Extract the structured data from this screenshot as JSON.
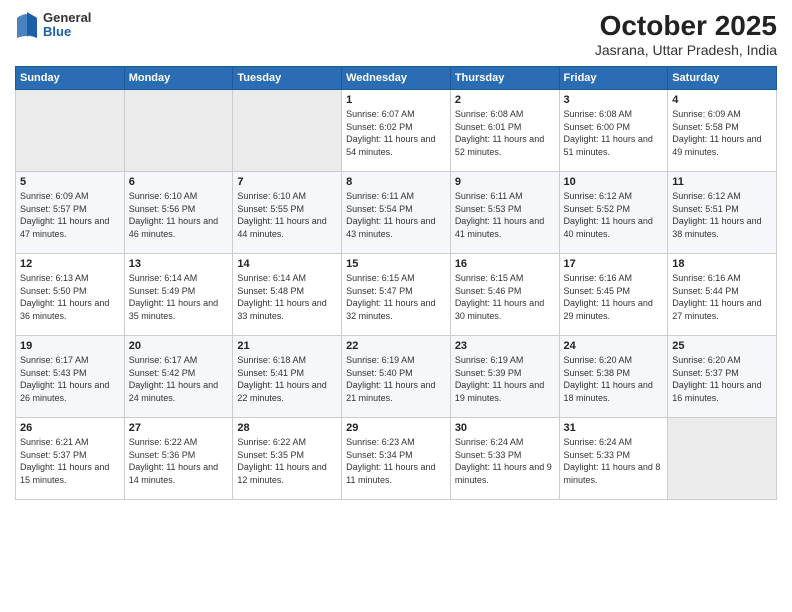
{
  "header": {
    "logo": {
      "general": "General",
      "blue": "Blue"
    },
    "title": "October 2025",
    "subtitle": "Jasrana, Uttar Pradesh, India"
  },
  "weekdays": [
    "Sunday",
    "Monday",
    "Tuesday",
    "Wednesday",
    "Thursday",
    "Friday",
    "Saturday"
  ],
  "weeks": [
    [
      {
        "day": "",
        "sunrise": "",
        "sunset": "",
        "daylight": ""
      },
      {
        "day": "",
        "sunrise": "",
        "sunset": "",
        "daylight": ""
      },
      {
        "day": "",
        "sunrise": "",
        "sunset": "",
        "daylight": ""
      },
      {
        "day": "1",
        "sunrise": "Sunrise: 6:07 AM",
        "sunset": "Sunset: 6:02 PM",
        "daylight": "Daylight: 11 hours and 54 minutes."
      },
      {
        "day": "2",
        "sunrise": "Sunrise: 6:08 AM",
        "sunset": "Sunset: 6:01 PM",
        "daylight": "Daylight: 11 hours and 52 minutes."
      },
      {
        "day": "3",
        "sunrise": "Sunrise: 6:08 AM",
        "sunset": "Sunset: 6:00 PM",
        "daylight": "Daylight: 11 hours and 51 minutes."
      },
      {
        "day": "4",
        "sunrise": "Sunrise: 6:09 AM",
        "sunset": "Sunset: 5:58 PM",
        "daylight": "Daylight: 11 hours and 49 minutes."
      }
    ],
    [
      {
        "day": "5",
        "sunrise": "Sunrise: 6:09 AM",
        "sunset": "Sunset: 5:57 PM",
        "daylight": "Daylight: 11 hours and 47 minutes."
      },
      {
        "day": "6",
        "sunrise": "Sunrise: 6:10 AM",
        "sunset": "Sunset: 5:56 PM",
        "daylight": "Daylight: 11 hours and 46 minutes."
      },
      {
        "day": "7",
        "sunrise": "Sunrise: 6:10 AM",
        "sunset": "Sunset: 5:55 PM",
        "daylight": "Daylight: 11 hours and 44 minutes."
      },
      {
        "day": "8",
        "sunrise": "Sunrise: 6:11 AM",
        "sunset": "Sunset: 5:54 PM",
        "daylight": "Daylight: 11 hours and 43 minutes."
      },
      {
        "day": "9",
        "sunrise": "Sunrise: 6:11 AM",
        "sunset": "Sunset: 5:53 PM",
        "daylight": "Daylight: 11 hours and 41 minutes."
      },
      {
        "day": "10",
        "sunrise": "Sunrise: 6:12 AM",
        "sunset": "Sunset: 5:52 PM",
        "daylight": "Daylight: 11 hours and 40 minutes."
      },
      {
        "day": "11",
        "sunrise": "Sunrise: 6:12 AM",
        "sunset": "Sunset: 5:51 PM",
        "daylight": "Daylight: 11 hours and 38 minutes."
      }
    ],
    [
      {
        "day": "12",
        "sunrise": "Sunrise: 6:13 AM",
        "sunset": "Sunset: 5:50 PM",
        "daylight": "Daylight: 11 hours and 36 minutes."
      },
      {
        "day": "13",
        "sunrise": "Sunrise: 6:14 AM",
        "sunset": "Sunset: 5:49 PM",
        "daylight": "Daylight: 11 hours and 35 minutes."
      },
      {
        "day": "14",
        "sunrise": "Sunrise: 6:14 AM",
        "sunset": "Sunset: 5:48 PM",
        "daylight": "Daylight: 11 hours and 33 minutes."
      },
      {
        "day": "15",
        "sunrise": "Sunrise: 6:15 AM",
        "sunset": "Sunset: 5:47 PM",
        "daylight": "Daylight: 11 hours and 32 minutes."
      },
      {
        "day": "16",
        "sunrise": "Sunrise: 6:15 AM",
        "sunset": "Sunset: 5:46 PM",
        "daylight": "Daylight: 11 hours and 30 minutes."
      },
      {
        "day": "17",
        "sunrise": "Sunrise: 6:16 AM",
        "sunset": "Sunset: 5:45 PM",
        "daylight": "Daylight: 11 hours and 29 minutes."
      },
      {
        "day": "18",
        "sunrise": "Sunrise: 6:16 AM",
        "sunset": "Sunset: 5:44 PM",
        "daylight": "Daylight: 11 hours and 27 minutes."
      }
    ],
    [
      {
        "day": "19",
        "sunrise": "Sunrise: 6:17 AM",
        "sunset": "Sunset: 5:43 PM",
        "daylight": "Daylight: 11 hours and 26 minutes."
      },
      {
        "day": "20",
        "sunrise": "Sunrise: 6:17 AM",
        "sunset": "Sunset: 5:42 PM",
        "daylight": "Daylight: 11 hours and 24 minutes."
      },
      {
        "day": "21",
        "sunrise": "Sunrise: 6:18 AM",
        "sunset": "Sunset: 5:41 PM",
        "daylight": "Daylight: 11 hours and 22 minutes."
      },
      {
        "day": "22",
        "sunrise": "Sunrise: 6:19 AM",
        "sunset": "Sunset: 5:40 PM",
        "daylight": "Daylight: 11 hours and 21 minutes."
      },
      {
        "day": "23",
        "sunrise": "Sunrise: 6:19 AM",
        "sunset": "Sunset: 5:39 PM",
        "daylight": "Daylight: 11 hours and 19 minutes."
      },
      {
        "day": "24",
        "sunrise": "Sunrise: 6:20 AM",
        "sunset": "Sunset: 5:38 PM",
        "daylight": "Daylight: 11 hours and 18 minutes."
      },
      {
        "day": "25",
        "sunrise": "Sunrise: 6:20 AM",
        "sunset": "Sunset: 5:37 PM",
        "daylight": "Daylight: 11 hours and 16 minutes."
      }
    ],
    [
      {
        "day": "26",
        "sunrise": "Sunrise: 6:21 AM",
        "sunset": "Sunset: 5:37 PM",
        "daylight": "Daylight: 11 hours and 15 minutes."
      },
      {
        "day": "27",
        "sunrise": "Sunrise: 6:22 AM",
        "sunset": "Sunset: 5:36 PM",
        "daylight": "Daylight: 11 hours and 14 minutes."
      },
      {
        "day": "28",
        "sunrise": "Sunrise: 6:22 AM",
        "sunset": "Sunset: 5:35 PM",
        "daylight": "Daylight: 11 hours and 12 minutes."
      },
      {
        "day": "29",
        "sunrise": "Sunrise: 6:23 AM",
        "sunset": "Sunset: 5:34 PM",
        "daylight": "Daylight: 11 hours and 11 minutes."
      },
      {
        "day": "30",
        "sunrise": "Sunrise: 6:24 AM",
        "sunset": "Sunset: 5:33 PM",
        "daylight": "Daylight: 11 hours and 9 minutes."
      },
      {
        "day": "31",
        "sunrise": "Sunrise: 6:24 AM",
        "sunset": "Sunset: 5:33 PM",
        "daylight": "Daylight: 11 hours and 8 minutes."
      },
      {
        "day": "",
        "sunrise": "",
        "sunset": "",
        "daylight": ""
      }
    ]
  ]
}
